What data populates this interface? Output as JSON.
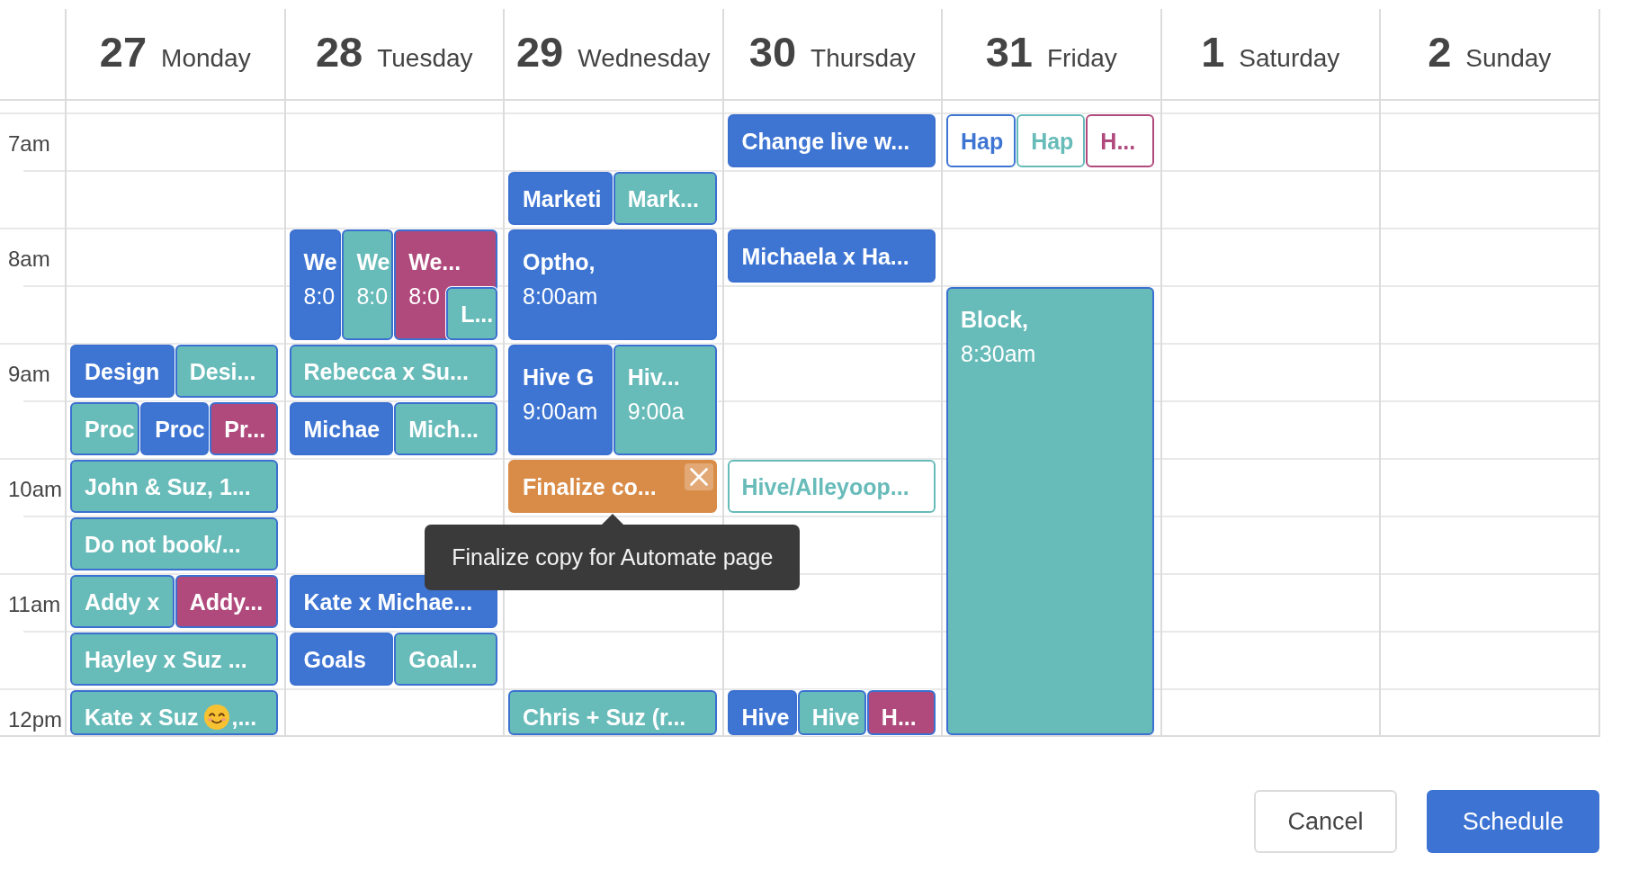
{
  "time_labels": [
    "7am",
    "8am",
    "9am",
    "10am",
    "11am",
    "12pm"
  ],
  "days": [
    {
      "number": "27",
      "name": "Monday",
      "events": [
        {
          "title": "Design",
          "color": "#3e75d3",
          "outlined": false,
          "hovered": false
        },
        {
          "title": "Desi...",
          "color": "#67bbb9",
          "outlined": false,
          "hovered": false
        },
        {
          "title": "Proc",
          "color": "#67bbb9",
          "outlined": false,
          "hovered": false
        },
        {
          "title": "Proc",
          "color": "#3e75d3",
          "outlined": false,
          "hovered": false
        },
        {
          "title": "Pr...",
          "color": "#b04a7d",
          "outlined": false,
          "hovered": false
        },
        {
          "title": "John & Suz, 1...",
          "color": "#67bbb9",
          "outlined": false,
          "hovered": false
        },
        {
          "title": "Do not book/...",
          "color": "#67bbb9",
          "outlined": false,
          "hovered": false
        },
        {
          "title": "Addy x",
          "color": "#67bbb9",
          "outlined": false,
          "hovered": false
        },
        {
          "title": "Addy...",
          "color": "#b04a7d",
          "outlined": false,
          "hovered": false
        },
        {
          "title": "Hayley x Suz ...",
          "color": "#67bbb9",
          "outlined": false,
          "hovered": false
        },
        {
          "title": "Kate x Suz",
          "title_rest": ",...",
          "color": "#67bbb9",
          "outlined": false,
          "hovered": false
        }
      ]
    },
    {
      "number": "28",
      "name": "Tuesday",
      "events": [
        {
          "title": "We",
          "time": "8:0",
          "color": "#3e75d3",
          "outlined": false,
          "hovered": false
        },
        {
          "title": "We",
          "time": "8:0",
          "color": "#67bbb9",
          "outlined": false,
          "hovered": false
        },
        {
          "title": "We...",
          "time": "8:0",
          "color": "#b04a7d",
          "outlined": false,
          "hovered": false
        },
        {
          "title": "L...",
          "color": "#67bbb9",
          "outlined": false,
          "hovered": false
        },
        {
          "title": "Rebecca x Su...",
          "color": "#67bbb9",
          "outlined": false,
          "hovered": false
        },
        {
          "title": "Michae",
          "color": "#3e75d3",
          "outlined": false,
          "hovered": false
        },
        {
          "title": "Mich...",
          "color": "#67bbb9",
          "outlined": false,
          "hovered": false
        },
        {
          "title": "Kate x Michae...",
          "color": "#3e75d3",
          "outlined": false,
          "hovered": false
        },
        {
          "title": "Goals",
          "color": "#3e75d3",
          "outlined": false,
          "hovered": false
        },
        {
          "title": "Goal...",
          "color": "#67bbb9",
          "outlined": false,
          "hovered": false
        }
      ]
    },
    {
      "number": "29",
      "name": "Wednesday",
      "events": [
        {
          "title": "Marketi",
          "color": "#3e75d3",
          "outlined": false,
          "hovered": false
        },
        {
          "title": "Mark...",
          "color": "#67bbb9",
          "outlined": false,
          "hovered": false
        },
        {
          "title": "Optho,",
          "time": "8:00am",
          "color": "#3e75d3",
          "outlined": false,
          "hovered": false
        },
        {
          "title": "Hive G",
          "time": "9:00am",
          "color": "#3e75d3",
          "outlined": false,
          "hovered": false
        },
        {
          "title": "Hiv...",
          "time": "9:00a",
          "color": "#67bbb9",
          "outlined": false,
          "hovered": false
        },
        {
          "title": "Finalize co...",
          "color": "#d98c48",
          "outlined": false,
          "hovered": true,
          "tooltip": "Finalize copy for Automate page"
        },
        {
          "title": "Chris + Suz (r...",
          "color": "#67bbb9",
          "outlined": false,
          "hovered": false
        }
      ]
    },
    {
      "number": "30",
      "name": "Thursday",
      "events": [
        {
          "title": "Change live w...",
          "color": "#3e75d3",
          "outlined": false,
          "hovered": false
        },
        {
          "title": "Michaela x Ha...",
          "color": "#3e75d3",
          "outlined": false,
          "hovered": false
        },
        {
          "title": "Hive/Alleyoop...",
          "color": "#67bbb9",
          "outlined": true,
          "hovered": false
        },
        {
          "title": "Hive",
          "color": "#3e75d3",
          "outlined": false,
          "hovered": false
        },
        {
          "title": "Hive",
          "color": "#67bbb9",
          "outlined": false,
          "hovered": false
        },
        {
          "title": "H...",
          "color": "#b04a7d",
          "outlined": false,
          "hovered": false
        }
      ]
    },
    {
      "number": "31",
      "name": "Friday",
      "events": [
        {
          "title": "Hap",
          "color": "#3e75d3",
          "outlined": true,
          "hovered": false
        },
        {
          "title": "Hap",
          "color": "#67bbb9",
          "outlined": true,
          "hovered": false
        },
        {
          "title": "H...",
          "color": "#b04a7d",
          "outlined": true,
          "hovered": false
        },
        {
          "title": "Block,",
          "time": "8:30am",
          "color": "#67bbb9",
          "outlined": false,
          "hovered": false
        }
      ]
    },
    {
      "number": "1",
      "name": "Saturday"
    },
    {
      "number": "2",
      "name": "Sunday"
    }
  ],
  "buttons": [
    {
      "label": "Cancel",
      "kind": "secondary"
    },
    {
      "label": "Schedule",
      "kind": "primary"
    }
  ]
}
